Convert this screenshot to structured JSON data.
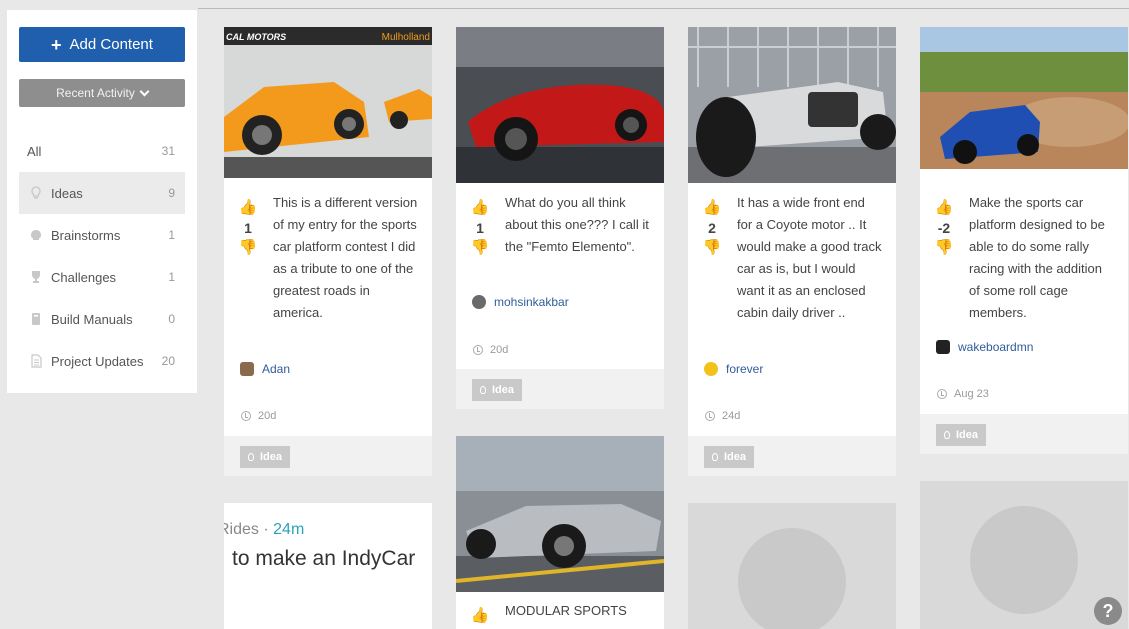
{
  "sidebar": {
    "add_label": "Add Content",
    "recent_label": "Recent Activity",
    "filters": [
      {
        "label": "All",
        "count": "31"
      },
      {
        "label": "Ideas",
        "count": "9"
      },
      {
        "label": "Brainstorms",
        "count": "1"
      },
      {
        "label": "Challenges",
        "count": "1"
      },
      {
        "label": "Build Manuals",
        "count": "0"
      },
      {
        "label": "Project Updates",
        "count": "20"
      }
    ]
  },
  "cards": [
    {
      "thumb_banner_left": "CAL MOTORS",
      "thumb_banner_right": "Mulholland",
      "votes": "1",
      "text": "This is a different version of my entry for the sports car platform contest I did as a tribute to one of the greatest roads in america.",
      "author": "Adan",
      "time": "20d",
      "tag": "Idea"
    },
    {
      "votes": "1",
      "text": "What do you all think about this one??? I call it the \"Femto Elemento\".",
      "author": "mohsinkakbar",
      "time": "20d",
      "tag": "Idea"
    },
    {
      "votes": "2",
      "text": "It has a wide front end for a Coyote motor .. It would make a good track car as is, but I would want it as an enclosed cabin daily driver ..",
      "author": "forever",
      "time": "24d",
      "tag": "Idea"
    },
    {
      "votes": "-2",
      "text": "Make the sports car platform designed to be able to do some rally racing with the addition of some roll cage members.",
      "author": "wakeboardmn",
      "time": "Aug 23",
      "tag": "Idea"
    }
  ],
  "post_card": {
    "source": "Rides",
    "time": "24m",
    "headline": "to make an IndyCar"
  },
  "modular_card": {
    "text": "MODULAR SPORTS"
  },
  "help_label": "?"
}
